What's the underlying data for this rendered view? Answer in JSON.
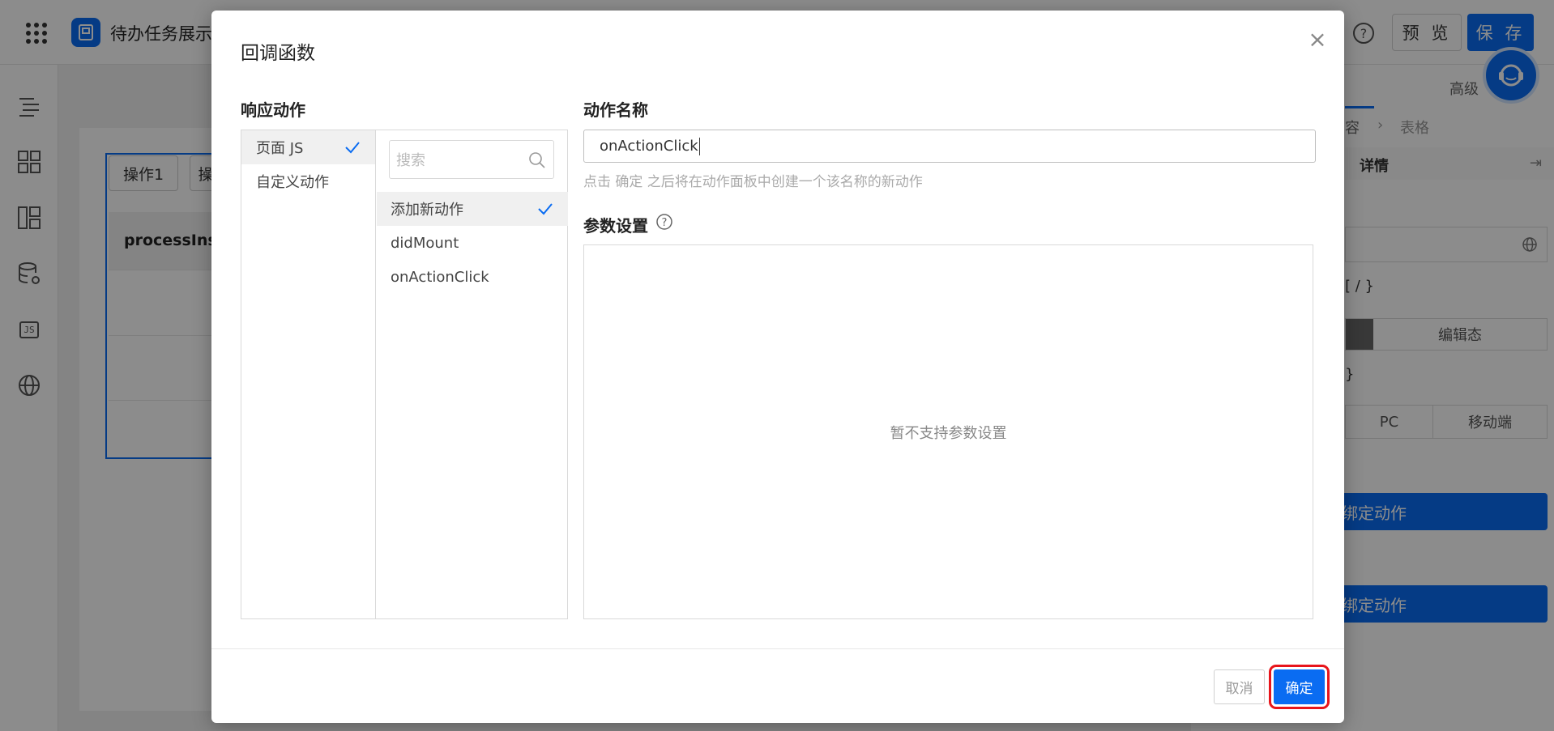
{
  "topbar": {
    "app_title": "待办任务展示",
    "preview_label": "预 览",
    "save_label": "保 存",
    "icons": [
      "apps-grid-icon",
      "app-logo-icon",
      "help-icon"
    ]
  },
  "left_sidebar": {
    "icons": [
      "outline-icon",
      "components-icon",
      "layout-icon",
      "datasource-icon",
      "js-icon",
      "globe-icon"
    ],
    "js_label": "JS"
  },
  "canvas": {
    "op_buttons": [
      "操作1",
      "操"
    ],
    "table_header": "processInst"
  },
  "right_panel": {
    "advanced_label": "高级",
    "breadcrumb_partial": "容",
    "breadcrumb_current": "表格",
    "section_title": "详情",
    "brace_text_1": "[ / }",
    "edit_state_label": "编辑态",
    "brace_text_2": "}",
    "pc_label": "PC",
    "mobile_label": "移动端",
    "bind_action_1": "绑定动作",
    "bind_action_2": "绑定动作"
  },
  "modal": {
    "title": "回调函数",
    "close_label": "×",
    "response_section_label": "响应动作",
    "action_types": [
      {
        "label": "页面 JS",
        "selected": true
      },
      {
        "label": "自定义动作",
        "selected": false
      }
    ],
    "search_placeholder": "搜索",
    "actions": [
      {
        "label": "添加新动作",
        "selected": true
      },
      {
        "label": "didMount",
        "selected": false
      },
      {
        "label": "onActionClick",
        "selected": false
      }
    ],
    "action_name_label": "动作名称",
    "action_name_value": "onActionClick",
    "action_name_hint": "点击 确定 之后将在动作面板中创建一个该名称的新动作",
    "param_section_label": "参数设置",
    "param_empty_text": "暂不支持参数设置",
    "cancel_label": "取消",
    "ok_label": "确定"
  },
  "colors": {
    "brand_blue": "#0a6cf2",
    "highlight_red": "#e8151b",
    "overlay": "rgba(0,0,0,0.45)"
  }
}
